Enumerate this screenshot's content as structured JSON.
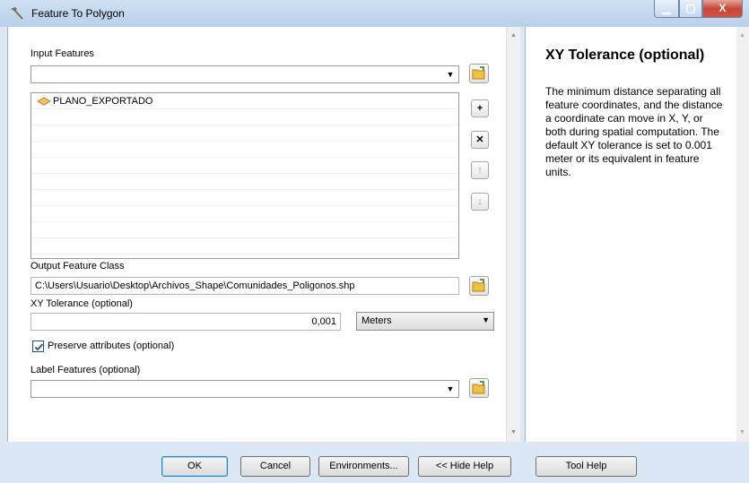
{
  "window": {
    "title": "Feature To Polygon"
  },
  "form": {
    "input_features_label": "Input Features",
    "input_features_value": "",
    "input_list": [
      "PLANO_EXPORTADO"
    ],
    "output_label": "Output Feature Class",
    "output_value": "C:\\Users\\Usuario\\Desktop\\Archivos_Shape\\Comunidades_Poligonos.shp",
    "xy_label": "XY Tolerance (optional)",
    "xy_value": "0,001",
    "xy_units": "Meters",
    "preserve_label": "Preserve attributes (optional)",
    "preserve_checked": true,
    "label_features_label": "Label Features (optional)",
    "label_features_value": ""
  },
  "help": {
    "title": "XY Tolerance (optional)",
    "body": "The minimum distance separating all feature coordinates, and the distance a coordinate can move in X, Y, or both during spatial computation. The default XY tolerance is set to 0.001 meter or its equivalent in feature units."
  },
  "buttons": {
    "ok": "OK",
    "cancel": "Cancel",
    "environments": "Environments...",
    "hide_help": "<< Hide Help",
    "tool_help": "Tool Help"
  },
  "side_buttons": {
    "add": "+",
    "remove": "✕",
    "up": "↑",
    "down": "↓"
  }
}
